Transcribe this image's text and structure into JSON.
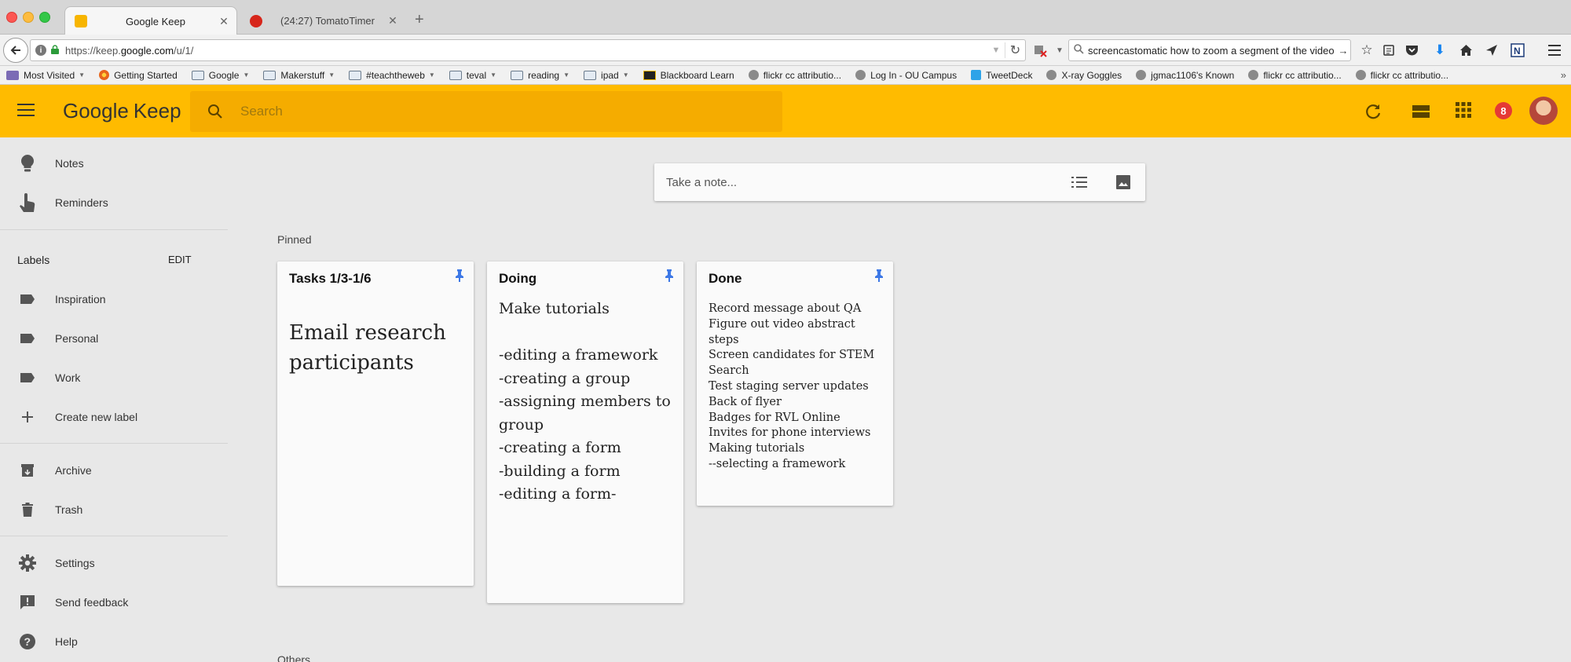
{
  "browser": {
    "tabs": [
      {
        "title": "Google Keep",
        "active": true,
        "favicon_color": "#f7b500"
      },
      {
        "title": "(24:27) TomatoTimer",
        "active": false,
        "favicon_color": "#d7261b"
      }
    ],
    "close_glyph": "✕",
    "new_tab_glyph": "+",
    "url_prefix": "https://keep.",
    "url_domain": "google.com",
    "url_path": "/u/1/",
    "search_query": "screencastomatic how to zoom a segment of the video",
    "bookmarks": [
      {
        "label": "Most Visited",
        "icon": "most-visited-icon",
        "dropdown": true
      },
      {
        "label": "Getting Started",
        "icon": "firefox-icon",
        "dropdown": false
      },
      {
        "label": "Google",
        "icon": "folder-icon",
        "dropdown": true
      },
      {
        "label": "Makerstuff",
        "icon": "folder-icon",
        "dropdown": true
      },
      {
        "label": "#teachtheweb",
        "icon": "folder-icon",
        "dropdown": true
      },
      {
        "label": "teval",
        "icon": "folder-icon",
        "dropdown": true
      },
      {
        "label": "reading",
        "icon": "folder-icon",
        "dropdown": true
      },
      {
        "label": "ipad",
        "icon": "folder-icon",
        "dropdown": true
      },
      {
        "label": "Blackboard Learn",
        "icon": "blackboard-icon",
        "dropdown": false
      },
      {
        "label": "flickr cc attributio...",
        "icon": "globe-icon",
        "dropdown": false
      },
      {
        "label": "Log In - OU Campus",
        "icon": "globe-icon",
        "dropdown": false
      },
      {
        "label": "TweetDeck",
        "icon": "tweetdeck-icon",
        "dropdown": false
      },
      {
        "label": "X-ray Goggles",
        "icon": "globe-icon",
        "dropdown": false
      },
      {
        "label": "jgmac1106's Known",
        "icon": "globe-icon",
        "dropdown": false
      },
      {
        "label": "flickr cc attributio...",
        "icon": "globe-icon",
        "dropdown": false
      },
      {
        "label": "flickr cc attributio...",
        "icon": "globe-icon",
        "dropdown": false
      }
    ],
    "more_glyph": "»"
  },
  "keep": {
    "logo_google": "Google",
    "logo_keep": "Keep",
    "search_placeholder": "Search",
    "notification_count": "8",
    "accent_color": "#ffbb00"
  },
  "sidebar": {
    "top_items": [
      {
        "label": "Notes",
        "icon": "lightbulb-icon"
      },
      {
        "label": "Reminders",
        "icon": "reminder-hand-icon"
      }
    ],
    "labels_heading": "Labels",
    "labels_edit": "EDIT",
    "labels": [
      {
        "label": "Inspiration",
        "icon": "label-icon"
      },
      {
        "label": "Personal",
        "icon": "label-icon"
      },
      {
        "label": "Work",
        "icon": "label-icon"
      }
    ],
    "create_label": "Create new label",
    "archive_items": [
      {
        "label": "Archive",
        "icon": "archive-icon"
      },
      {
        "label": "Trash",
        "icon": "trash-icon"
      }
    ],
    "bottom_items": [
      {
        "label": "Settings",
        "icon": "gear-icon"
      },
      {
        "label": "Send feedback",
        "icon": "feedback-icon"
      },
      {
        "label": "Help",
        "icon": "help-icon"
      }
    ]
  },
  "main": {
    "take_note_placeholder": "Take a note...",
    "pinned_label": "Pinned",
    "others_label": "Others",
    "notes": [
      {
        "title": "Tasks 1/3-1/6",
        "body": "Email research\nparticipants",
        "pinned": true
      },
      {
        "title": "Doing",
        "body": "Make tutorials\n\n-editing a framework\n-creating a group\n-assigning members to\ngroup\n-creating a form\n-building a form\n-editing a form-",
        "pinned": true
      },
      {
        "title": "Done",
        "body": "Record message about QA\nFigure out video abstract steps\nScreen candidates for STEM\nSearch\nTest staging server updates\nBack of flyer\nBadges for RVL Online\nInvites for phone interviews\nMaking tutorials\n--selecting a framework",
        "pinned": true
      }
    ]
  }
}
